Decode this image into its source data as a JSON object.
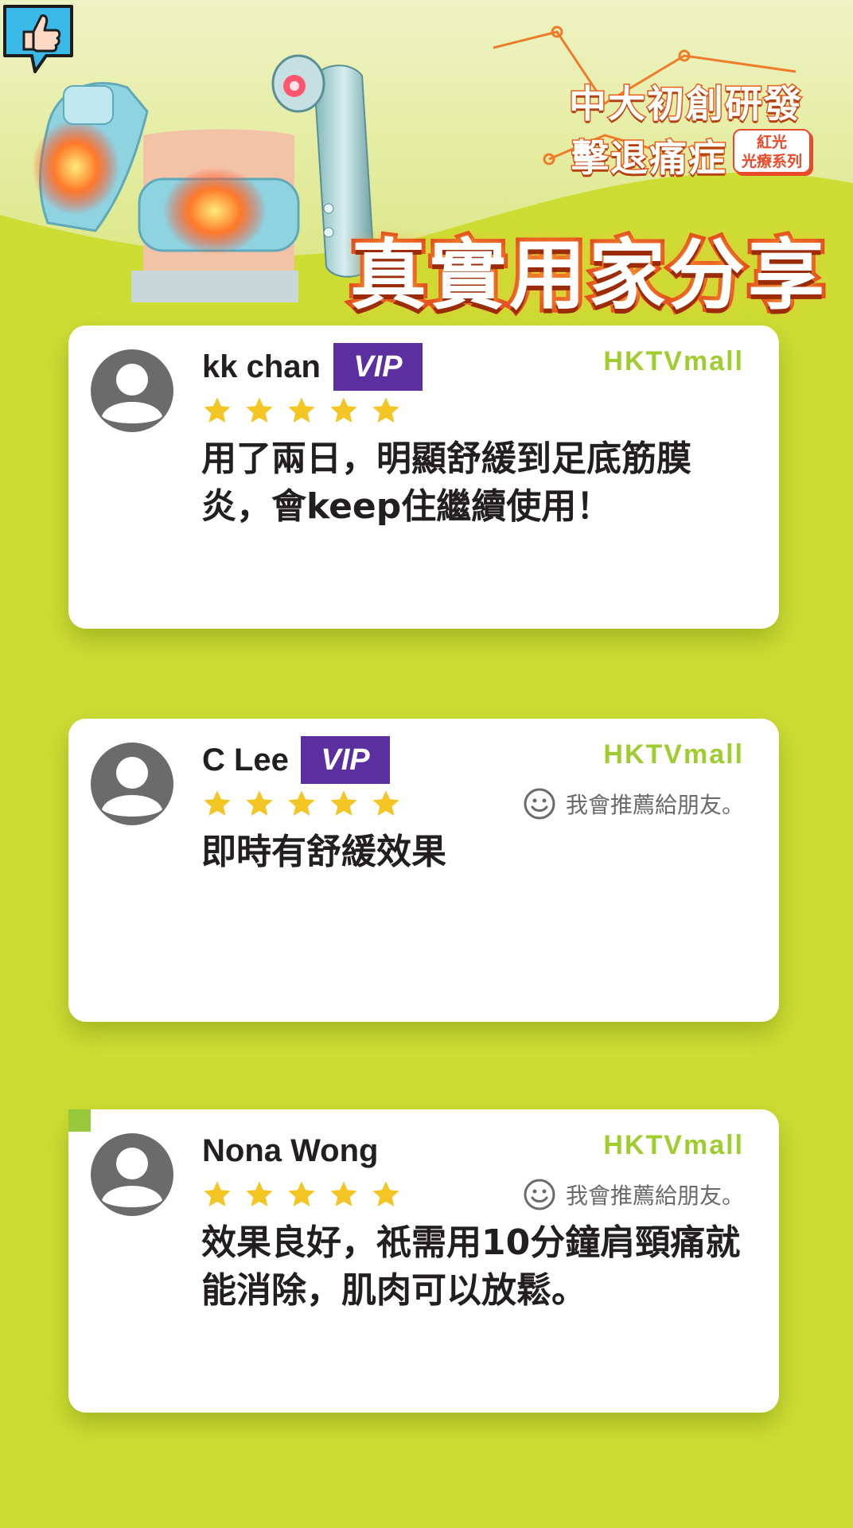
{
  "header": {
    "slogan_line1": "中大初創研發",
    "slogan_line2": "擊退痛症",
    "series_badge_line1": "紅光",
    "series_badge_line2": "光療系列",
    "title": "真實用家分享"
  },
  "reviews": [
    {
      "name": "kk chan",
      "vip": "VIP",
      "store": "HKTVmall",
      "rating": 5,
      "recommend": "",
      "text": "用了兩日，明顯舒緩到足底筋膜炎，會keep住繼續使用！"
    },
    {
      "name": "C Lee",
      "vip": "VIP",
      "store": "HKTVmall",
      "rating": 5,
      "recommend": "我會推薦給朋友。",
      "text": "即時有舒緩效果"
    },
    {
      "name": "Nona Wong",
      "vip": "",
      "store": "HKTVmall",
      "rating": 5,
      "recommend": "我會推薦給朋友。",
      "text": "效果良好，祇需用10分鐘肩頸痛就能消除，肌肉可以放鬆。"
    }
  ],
  "colors": {
    "background": "#cddd34",
    "accent_orange": "#e8601c",
    "vip_purple": "#5b2fa0",
    "store_green": "#9fcc2e",
    "star_yellow": "#f3c623"
  },
  "icons": [
    "thumbs-up-icon",
    "avatar-icon",
    "star-icon",
    "smile-icon",
    "sparkle-icon"
  ]
}
